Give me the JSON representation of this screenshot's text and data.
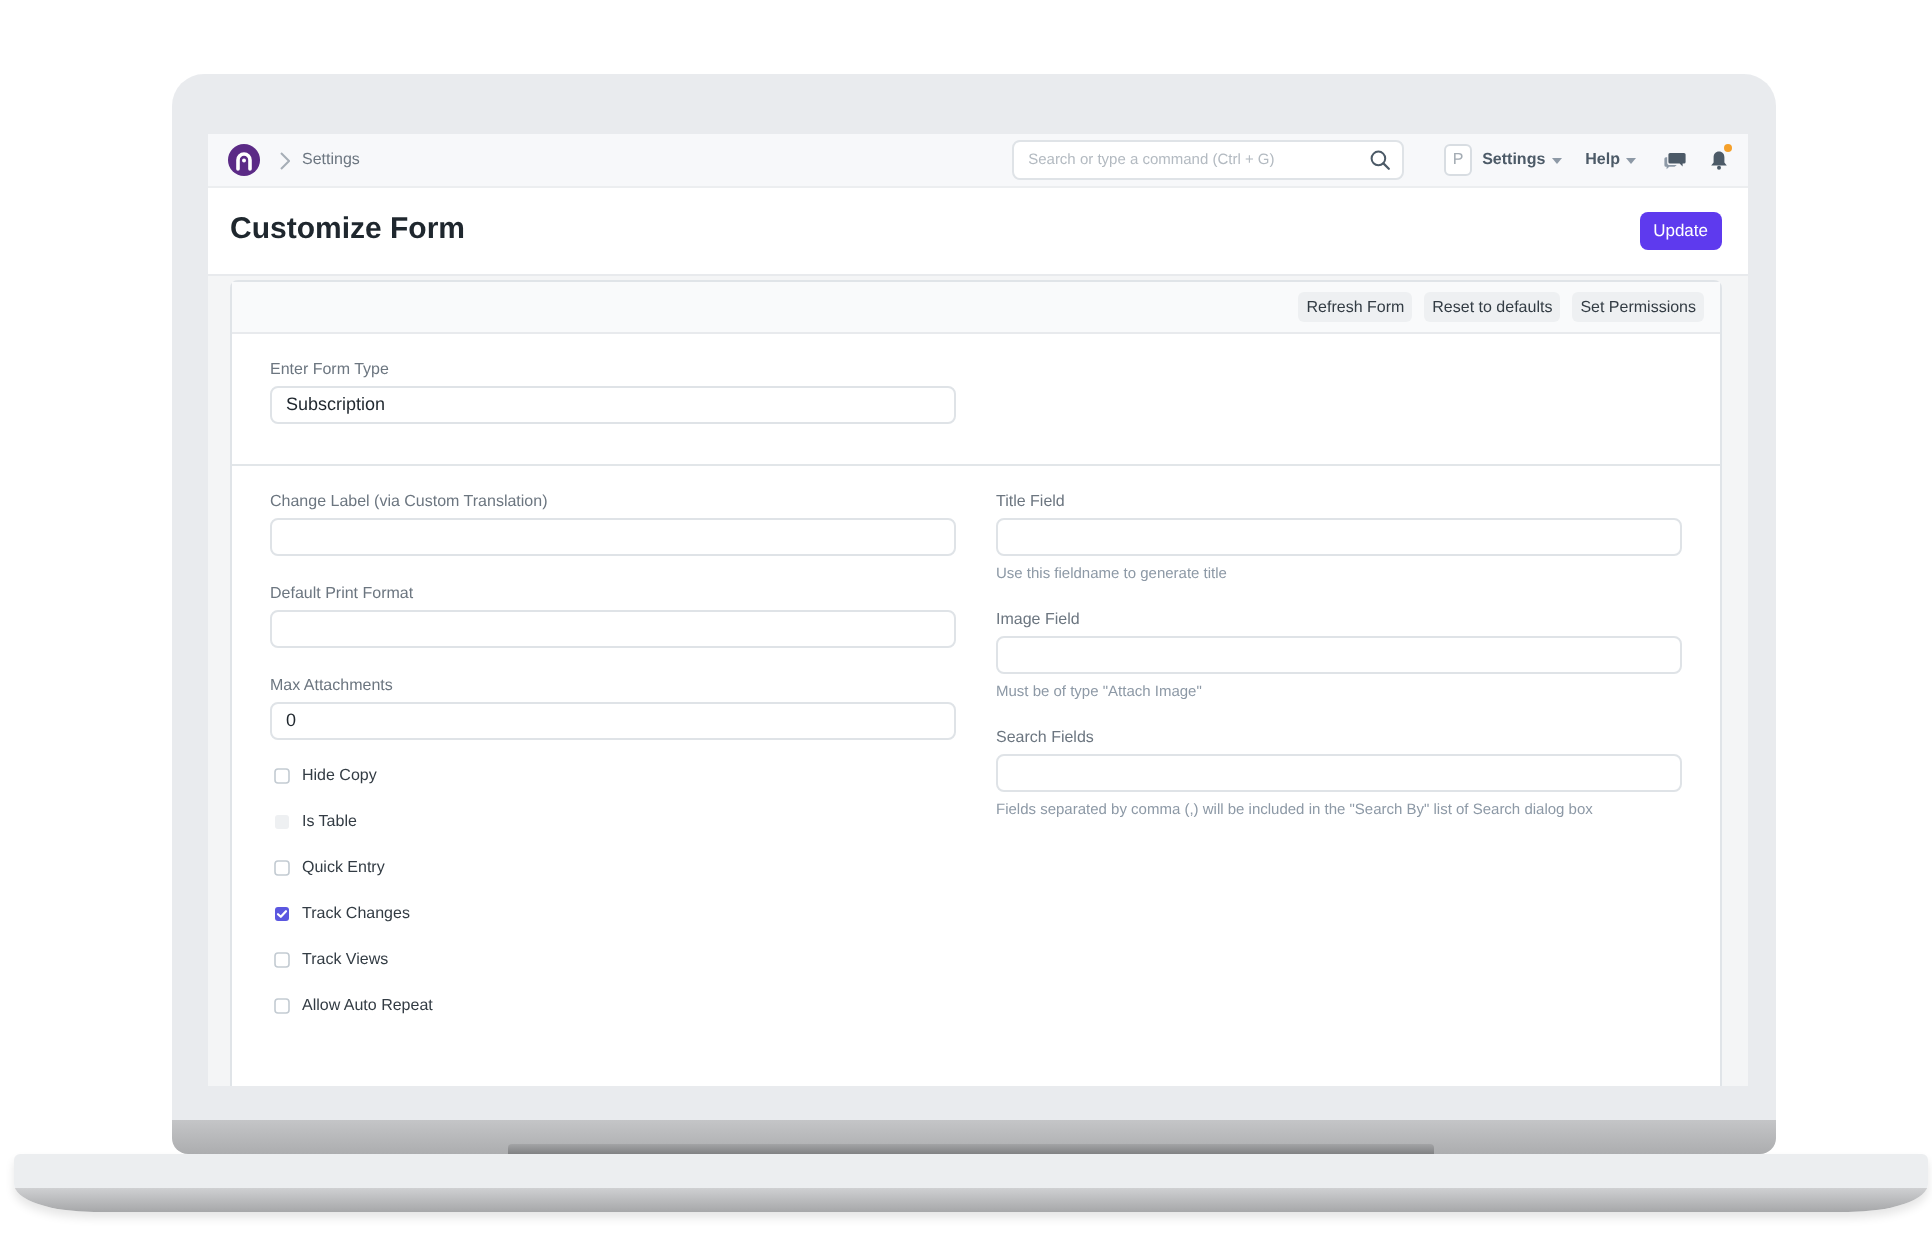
{
  "navbar": {
    "breadcrumb": [
      "Settings"
    ],
    "search": {
      "placeholder": "Search or type a command (Ctrl + G)"
    },
    "avatar": "P",
    "menus": [
      "Settings",
      "Help"
    ],
    "notifications": {
      "unread": true
    }
  },
  "page_header": {
    "title": "Customize Form",
    "primary_button": "Update"
  },
  "form_toolbar": {
    "buttons": [
      "Refresh Form",
      "Reset to defaults",
      "Set Permissions"
    ]
  },
  "sections": [
    {
      "columns": [
        [
          {
            "kind": "input",
            "label": "Enter Form Type",
            "value": "Subscription"
          }
        ]
      ]
    },
    {
      "columns": [
        [
          {
            "kind": "input",
            "label": "Change Label (via Custom Translation)"
          },
          {
            "kind": "input",
            "label": "Default Print Format"
          },
          {
            "kind": "input",
            "label": "Max Attachments",
            "value": "0"
          },
          {
            "kind": "checkbox",
            "label": "Hide Copy",
            "checked": false,
            "disabled": false
          },
          {
            "kind": "checkbox",
            "label": "Is Table",
            "checked": false,
            "disabled": true
          },
          {
            "kind": "checkbox",
            "label": "Quick Entry",
            "checked": false,
            "disabled": false
          },
          {
            "kind": "checkbox",
            "label": "Track Changes",
            "checked": true,
            "disabled": false
          },
          {
            "kind": "checkbox",
            "label": "Track Views",
            "checked": false,
            "disabled": false
          },
          {
            "kind": "checkbox",
            "label": "Allow Auto Repeat",
            "checked": false,
            "disabled": false
          }
        ],
        [
          {
            "kind": "input",
            "label": "Title Field",
            "hint": "Use this fieldname to generate title"
          },
          {
            "kind": "input",
            "label": "Image Field",
            "hint": "Must be of type \"Attach Image\""
          },
          {
            "kind": "input",
            "label": "Search Fields",
            "hint": "Fields separated by comma (,) will be included in the \"Search By\" list of Search dialog box"
          }
        ]
      ]
    }
  ]
}
